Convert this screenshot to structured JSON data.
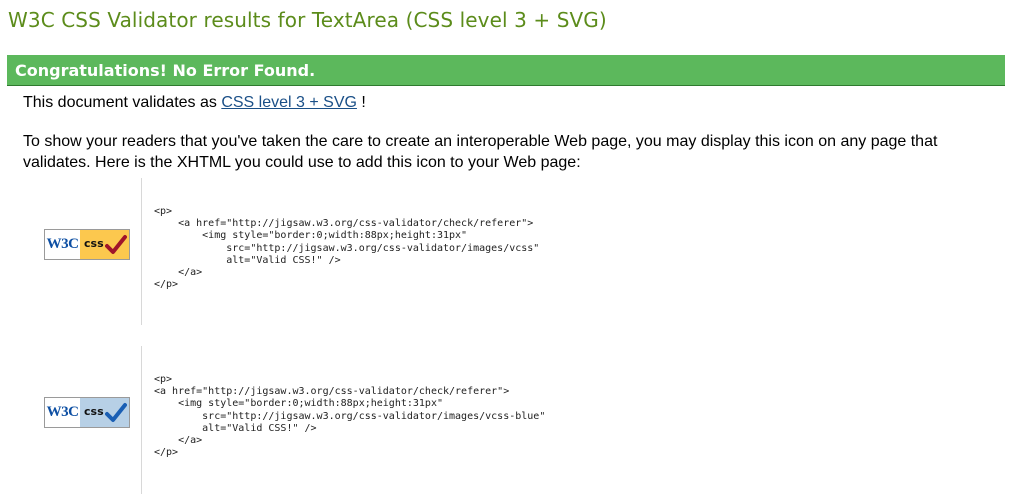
{
  "title": "W3C CSS Validator results for TextArea (CSS level 3 + SVG)",
  "congrats": "Congratulations! No Error Found.",
  "validates": {
    "prefix": "This document validates as",
    "link": "CSS level 3 + SVG",
    "suffix": "!"
  },
  "info": "To show your readers that you've taken the care to create an interoperable Web page, you may display this icon on any page that validates. Here is the XHTML you could use to add this icon to your Web page:",
  "badges": [
    {
      "w3c": "W3C",
      "css": "css",
      "check_color": "#a0142a",
      "background": "#fcc84e",
      "code": "<p>\n    <a href=\"http://jigsaw.w3.org/css-validator/check/referer\">\n        <img style=\"border:0;width:88px;height:31px\"\n            src=\"http://jigsaw.w3.org/css-validator/images/vcss\"\n            alt=\"Valid CSS!\" />\n    </a>\n</p>"
    },
    {
      "w3c": "W3C",
      "css": "css",
      "check_color": "#1a5fb4",
      "background": "#b7d0e6",
      "code": "<p>\n<a href=\"http://jigsaw.w3.org/css-validator/check/referer\">\n    <img style=\"border:0;width:88px;height:31px\"\n        src=\"http://jigsaw.w3.org/css-validator/images/vcss-blue\"\n        alt=\"Valid CSS!\" />\n    </a>\n</p>"
    }
  ]
}
